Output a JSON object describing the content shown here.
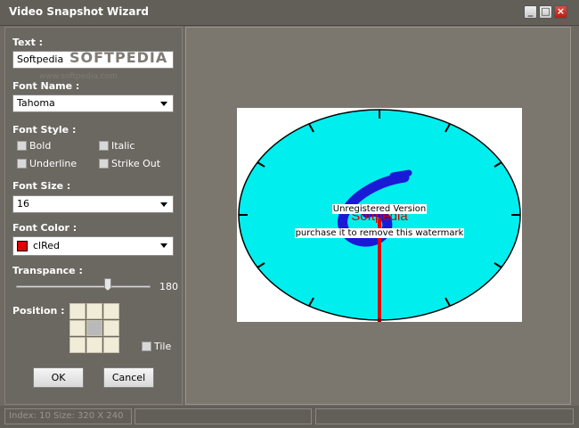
{
  "window": {
    "title": "Video Snapshot Wizard"
  },
  "controls": {
    "text_label": "Text :",
    "text_value": "Softpedia",
    "font_name_label": "Font Name :",
    "font_name_value": "Tahoma",
    "font_style_label": "Font Style :",
    "bold_label": "Bold",
    "italic_label": "Italic",
    "underline_label": "Underline",
    "strikeout_label": "Strike Out",
    "font_size_label": "Font Size :",
    "font_size_value": "16",
    "font_color_label": "Font Color :",
    "font_color_value": "clRed",
    "font_color_swatch": "#e00000",
    "transparence_label": "Transpance :",
    "transparence_value": "180",
    "position_label": "Position :",
    "position_selected": "center",
    "tile_label": "Tile",
    "ok_label": "OK",
    "cancel_label": "Cancel"
  },
  "background_watermark": {
    "brand": "SOFTPEDIA",
    "url": "www.softpedia.com"
  },
  "preview": {
    "watermark_line1": "Unregistered Version",
    "watermark_line2": "purchase it to remove this watermark",
    "overlay_text": "Softpedia",
    "colors": {
      "face": "#00eeee",
      "hand": "#e00000",
      "glyph": "#1a1ad6"
    }
  },
  "statusbar": {
    "info": "Index: 10  Size: 320 X 240"
  },
  "colors": {
    "window_bg": "#6e6a63",
    "panel_bg": "#6b6761"
  }
}
